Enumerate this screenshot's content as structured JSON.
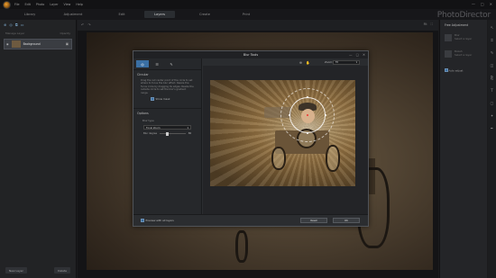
{
  "app": {
    "brand": "PhotoDirector",
    "menus": [
      "File",
      "Edit",
      "Photo",
      "Layer",
      "View",
      "Help"
    ],
    "window_controls": [
      "—",
      "□",
      "✕"
    ]
  },
  "modes": [
    {
      "label": "Library",
      "active": false
    },
    {
      "label": "Adjustment",
      "active": false
    },
    {
      "label": "Edit",
      "active": false
    },
    {
      "label": "Layers",
      "active": true
    },
    {
      "label": "Create",
      "active": false
    },
    {
      "label": "Print",
      "active": false
    }
  ],
  "left_panel": {
    "header_left": "Manage Layer",
    "header_right": "Opacity",
    "layer_name": "Background",
    "buttons": [
      "New Layer",
      "Delete"
    ]
  },
  "canvas": {
    "zoom_label": "Fit"
  },
  "right_panel": {
    "title": "Free Adjustment",
    "cards": [
      {
        "line1": "Blur",
        "line2": "Select a layer"
      },
      {
        "line1": "Bokeh",
        "line2": "Select a layer"
      }
    ],
    "check_label": "Auto adjust"
  },
  "dialog": {
    "title": "Blur Tools",
    "section": "Circular",
    "description": "Drag the red center point of the circle to set where to focus the blur effect. Resize the focus circle by dragging its edges. Resize the outside circle to set the blur's gradient range.",
    "show_mask": "Show mask",
    "options_label": "Options",
    "blur_type_label": "Blur type",
    "blur_type_value": "Focal Zoom",
    "blur_degree_label": "Blur degree",
    "blur_degree_value": "30",
    "blur_degree_max": 100,
    "zoom_label": "Zoom:",
    "zoom_value": "Fit",
    "preview_label": "Preview with all layers",
    "reset_button": "Reset",
    "ok_button": "OK"
  }
}
